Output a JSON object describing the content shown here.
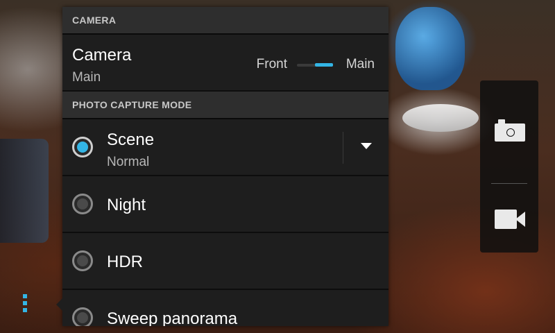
{
  "camera_section": {
    "header": "CAMERA",
    "camera_row": {
      "title": "Camera",
      "subtitle": "Main",
      "switch_left_label": "Front",
      "switch_right_label": "Main",
      "selected": "Main"
    }
  },
  "capture_section": {
    "header": "PHOTO CAPTURE MODE",
    "modes": [
      {
        "label": "Scene",
        "sublabel": "Normal",
        "selected": true
      },
      {
        "label": "Night",
        "selected": false
      },
      {
        "label": "HDR",
        "selected": false
      },
      {
        "label": "Sweep panorama",
        "selected": false
      }
    ]
  },
  "colors": {
    "accent": "#33b5e5",
    "panel_bg": "#1e1e1e",
    "header_bg": "#2e2e2e"
  },
  "icons": {
    "menu": "overflow-menu-icon",
    "photo_mode": "camera-icon",
    "video_mode": "video-camera-icon",
    "dropdown": "dropdown-arrow-icon"
  }
}
